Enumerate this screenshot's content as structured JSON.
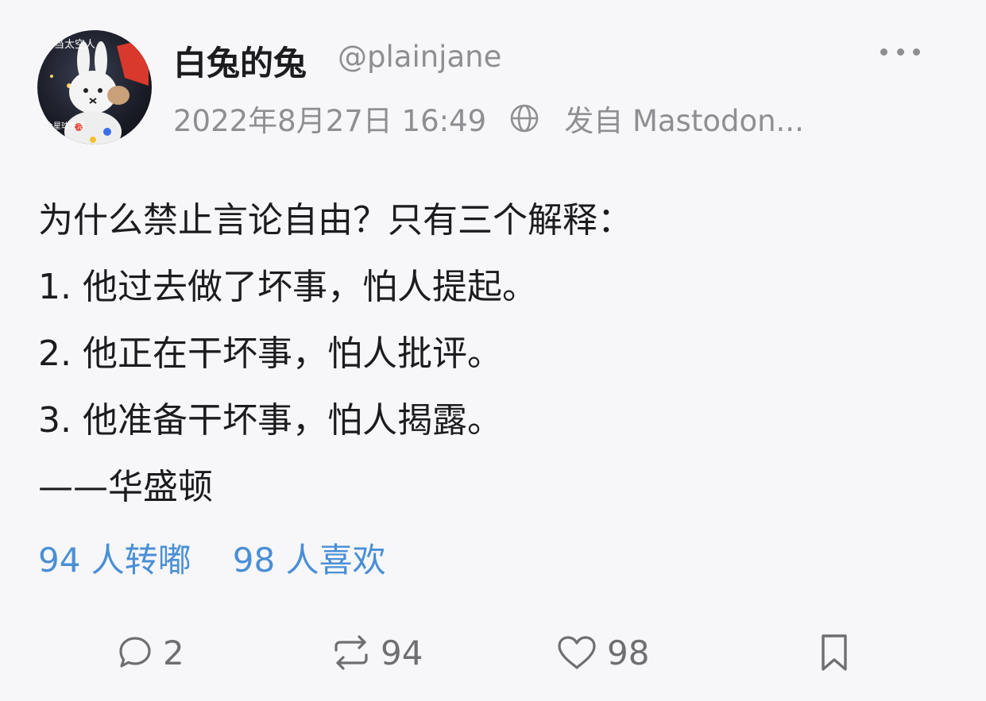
{
  "post": {
    "author": {
      "display_name": "白兔的兔",
      "handle": "@plainjane",
      "avatar_text_top": "去当太空人",
      "avatar_text_bottom": "个星球生活"
    },
    "timestamp": "2022年8月27日 16:49",
    "visibility_icon": "globe-icon",
    "source": "发自 Mastodon...",
    "content_lines": [
      "为什么禁止言论自由？只有三个解释：",
      "1. 他过去做了坏事，怕人提起。",
      "2. 他正在干坏事，怕人批评。",
      "3. 他准备干坏事，怕人揭露。",
      "——华盛顿"
    ],
    "stats": {
      "boosts_label": "94 人转嘟",
      "favourites_label": "98 人喜欢"
    },
    "actions": {
      "reply_count": "2",
      "boost_count": "94",
      "favourite_count": "98"
    }
  },
  "colors": {
    "background": "#f7f7f9",
    "text": "#1c1c1e",
    "secondary": "#8e8e93",
    "link": "#4a8fd6",
    "action_icon": "#6e6e73"
  }
}
